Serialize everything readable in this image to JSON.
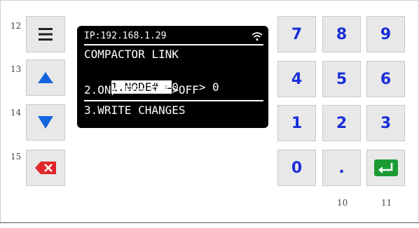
{
  "side_numbers": [
    "12",
    "13",
    "14",
    "15"
  ],
  "side_buttons": [
    {
      "name": "menu",
      "icon": "menu-icon"
    },
    {
      "name": "up",
      "icon": "arrow-up-icon"
    },
    {
      "name": "down",
      "icon": "arrow-down-icon"
    },
    {
      "name": "delete",
      "icon": "backspace-icon"
    }
  ],
  "display": {
    "ip_line": "IP:192.168.1.29",
    "title": "COMPACTOR LINK",
    "row1_label": "1.NODE# =",
    "row1_values": "0   > 0",
    "row2": "2.ON/OFF= OFF>OFF",
    "row3": "3.WRITE CHANGES",
    "wifi_icon": "wifi-icon"
  },
  "keypad": {
    "keys": [
      "7",
      "8",
      "9",
      "4",
      "5",
      "6",
      "1",
      "2",
      "3",
      "0",
      "."
    ],
    "enter_icon": "enter-icon"
  },
  "bottom_numbers": [
    "10",
    "11"
  ],
  "colors": {
    "key_text": "#1a2fd6",
    "arrow": "#1565e0",
    "delete": "#e0262b",
    "enter": "#1c9b35"
  }
}
